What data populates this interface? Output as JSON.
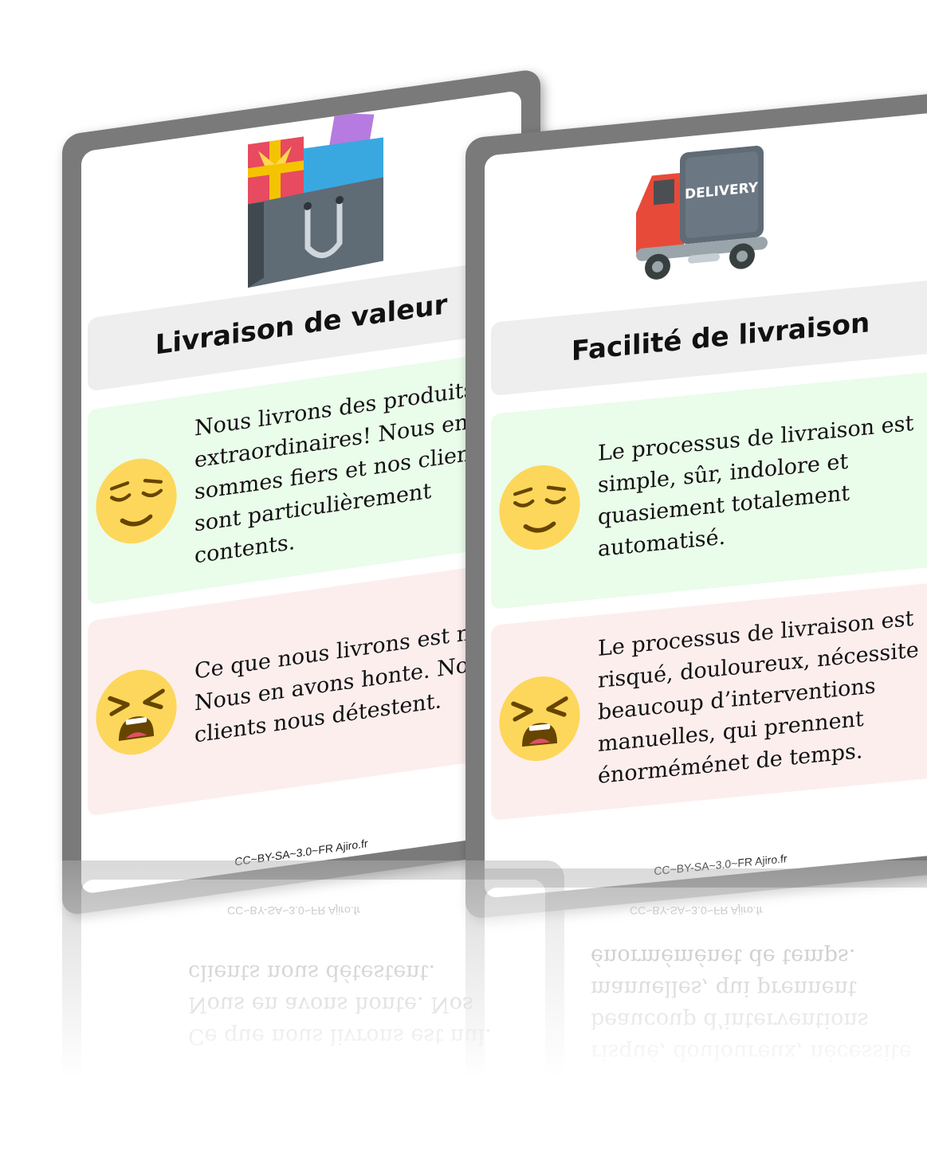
{
  "cards": [
    {
      "icon": "shopping-bag-icon",
      "title": "Livraison de valeur",
      "good_text": "Nous livrons des produits\nextraordinaires! Nous en\nsommes fiers et nos clients\nsont particulièrement\ncontents.",
      "bad_text": "Ce que nous livrons est nul.\nNous en avons honte. Nos\nclients nous détestent.",
      "good_face": "relieved-face-icon",
      "bad_face": "tired-face-icon",
      "footer": "CC~BY-SA~3.0~FR Ajiro.fr"
    },
    {
      "icon": "delivery-truck-icon",
      "icon_label": "DELIVERY",
      "title": "Facilité de livraison",
      "good_text": "Le processus de livraison est\nsimple, sûr, indolore et\nquasiement totalement\nautomatisé.",
      "bad_text": "Le processus de livraison est\nrisqué, douloureux, nécessite\nbeaucoup d’interventions\nmanuelles, qui prennent\nénorméménet de temps.",
      "good_face": "relieved-face-icon",
      "bad_face": "tired-face-icon",
      "footer": "CC~BY-SA~3.0~FR Ajiro.fr"
    }
  ],
  "colors": {
    "frame": "#7a7a7a",
    "good_panel": "#eafcea",
    "bad_panel": "#fdeeee",
    "title_band": "#eeeeee",
    "emoji_yellow": "#fdd75b"
  }
}
